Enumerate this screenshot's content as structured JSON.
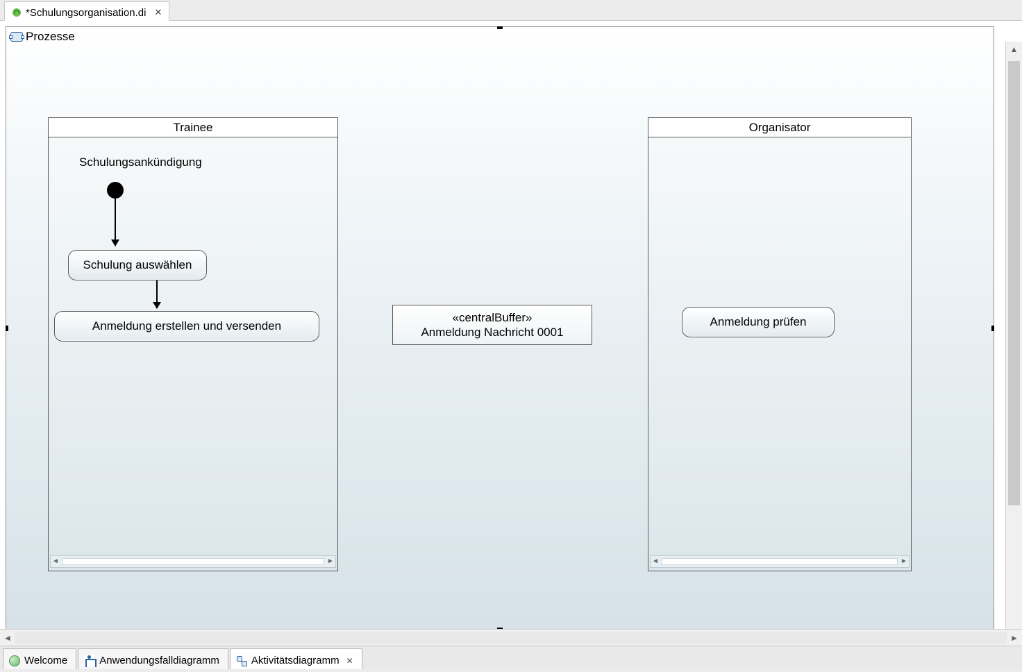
{
  "top_tab": {
    "label": "*Schulungsorganisation.di"
  },
  "canvas": {
    "activity_name": "Prozesse"
  },
  "diagram": {
    "partitions": {
      "trainee": {
        "title": "Trainee",
        "initial_label": "Schulungsankündigung",
        "action_select": "Schulung auswählen",
        "action_send": "Anmeldung erstellen und versenden"
      },
      "organisator": {
        "title": "Organisator",
        "action_check": "Anmeldung prüfen"
      }
    },
    "central_buffer": {
      "stereotype": "«centralBuffer»",
      "label": "Anmeldung Nachricht 0001"
    }
  },
  "bottom_tabs": {
    "welcome": "Welcome",
    "usecase": "Anwendungsfalldiagramm",
    "activity": "Aktivitätsdiagramm"
  }
}
